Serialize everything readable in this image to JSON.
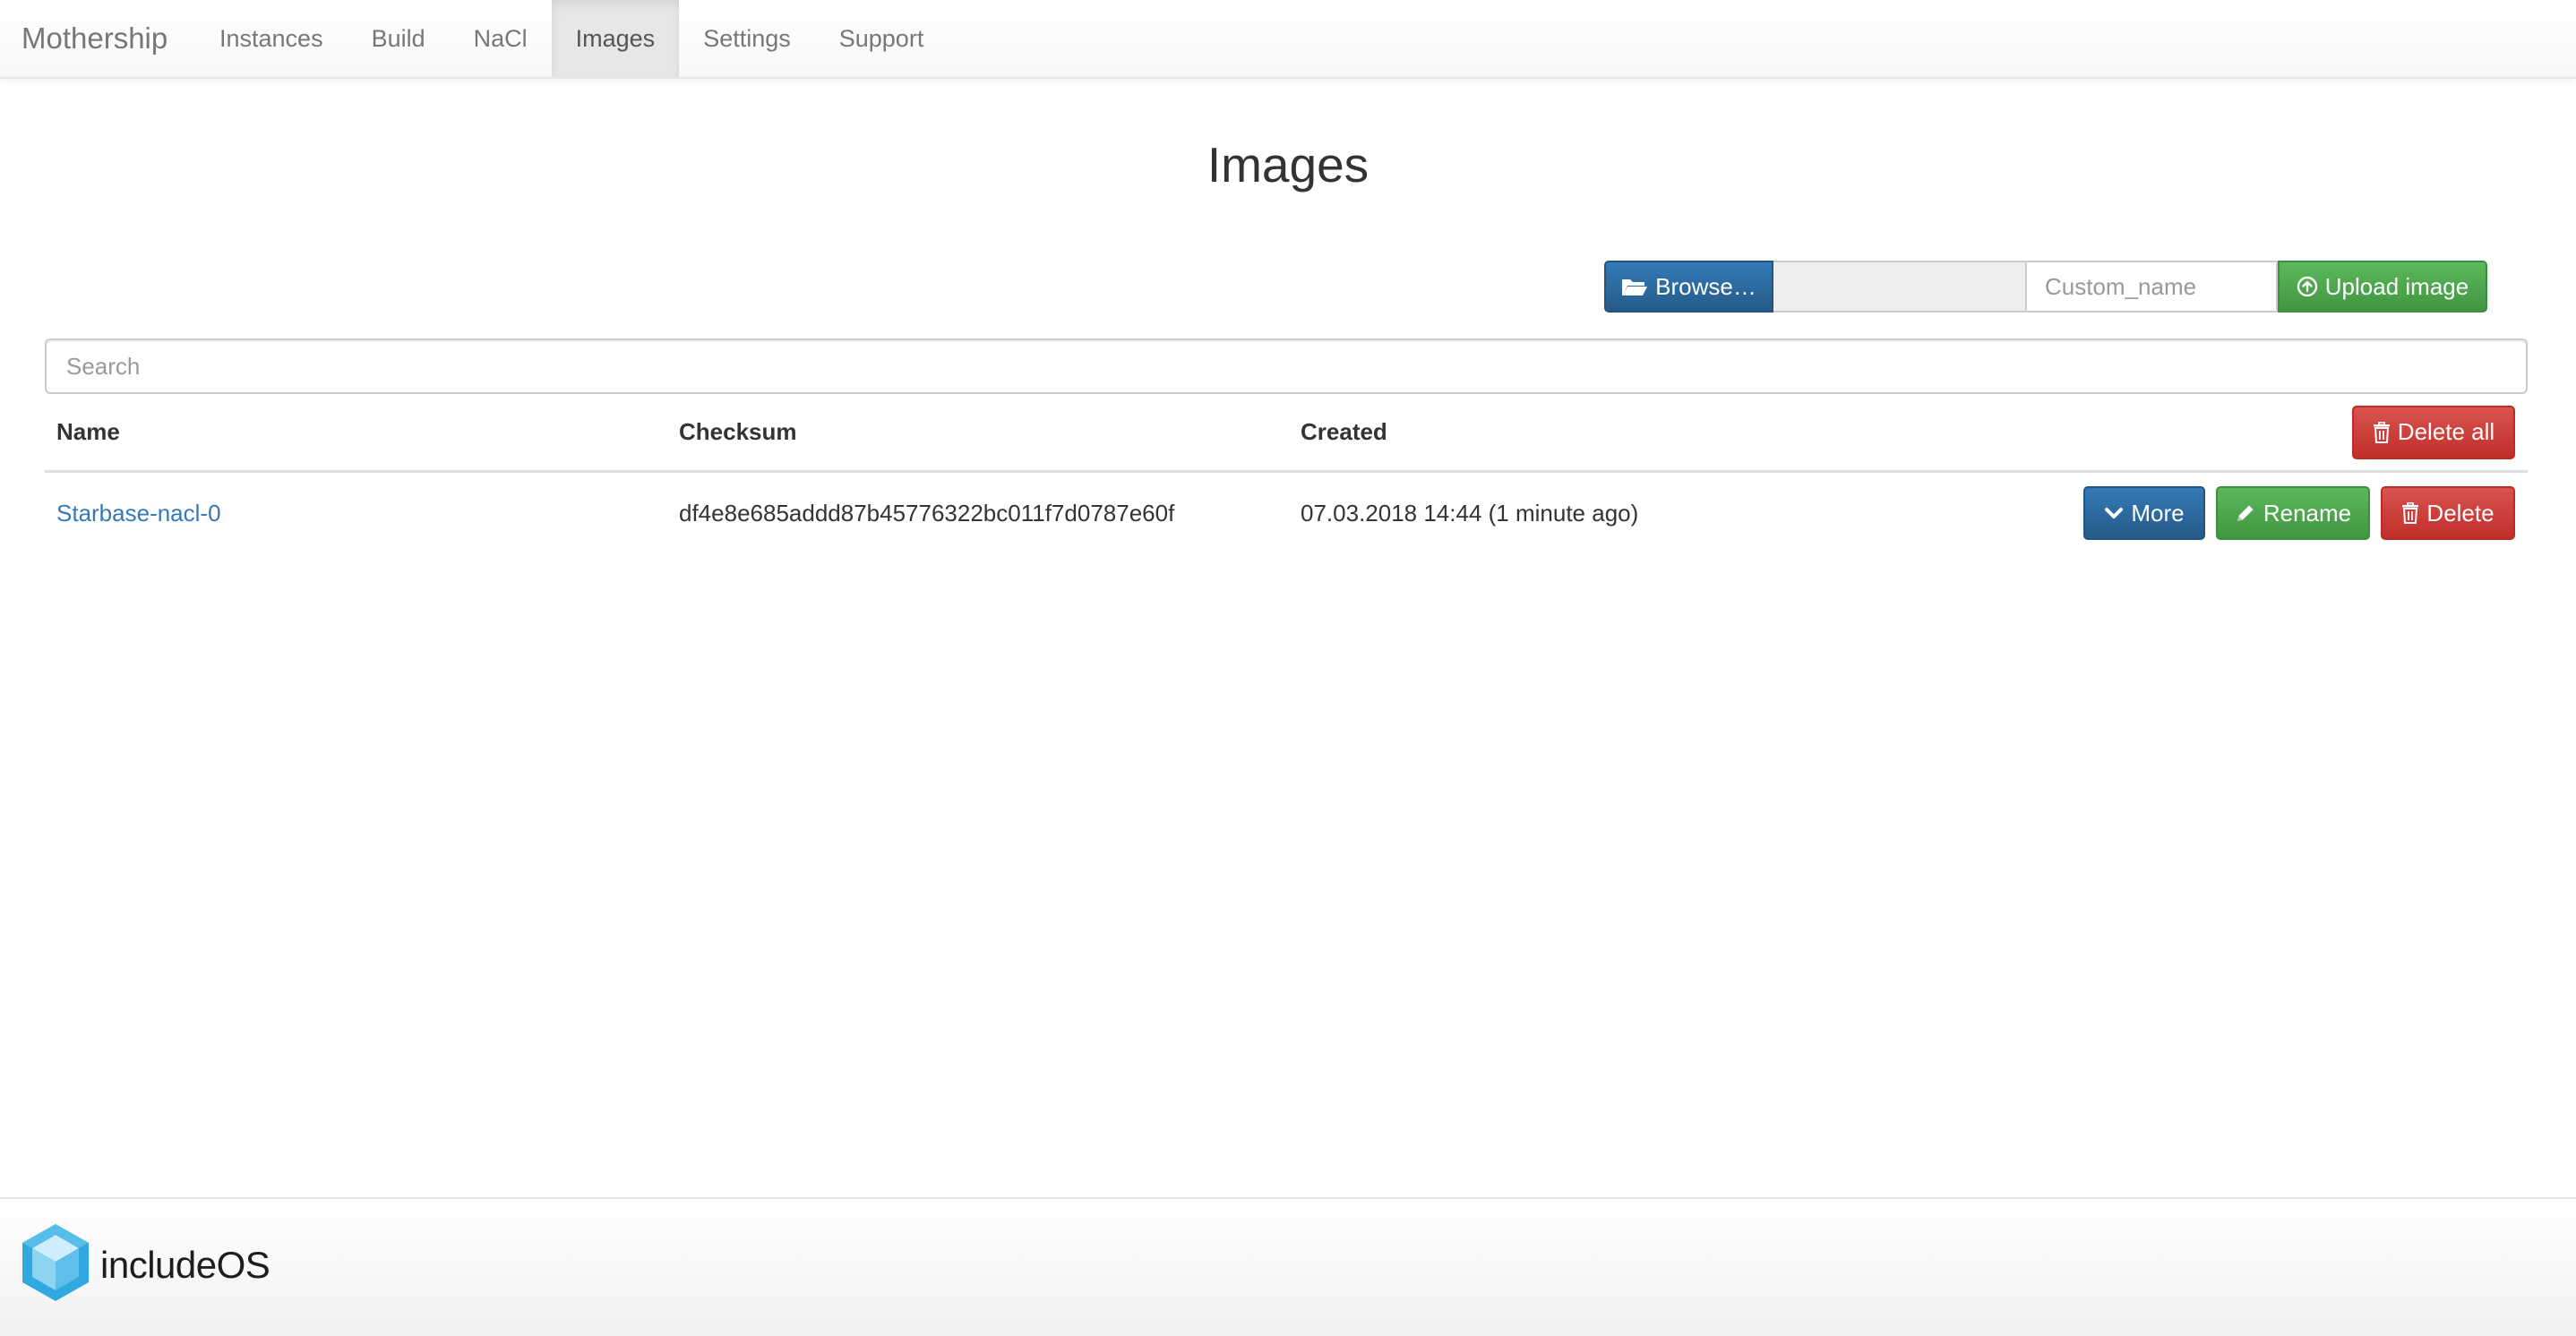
{
  "navbar": {
    "brand": "Mothership",
    "items": [
      {
        "label": "Instances",
        "active": false
      },
      {
        "label": "Build",
        "active": false
      },
      {
        "label": "NaCl",
        "active": false
      },
      {
        "label": "Images",
        "active": true
      },
      {
        "label": "Settings",
        "active": false
      },
      {
        "label": "Support",
        "active": false
      }
    ]
  },
  "page": {
    "title": "Images"
  },
  "upload": {
    "browse_label": "Browse…",
    "file_value": "",
    "custom_name_placeholder": "Custom_name",
    "upload_label": "Upload image"
  },
  "search": {
    "placeholder": "Search"
  },
  "table": {
    "headers": {
      "name": "Name",
      "checksum": "Checksum",
      "created": "Created",
      "delete_all_label": "Delete all"
    },
    "rows": [
      {
        "name": "Starbase-nacl-0",
        "checksum": "df4e8e685addd87b45776322bc011f7d0787e60f",
        "created": "07.03.2018 14:44 (1 minute ago)",
        "more_label": "More",
        "rename_label": "Rename",
        "delete_label": "Delete"
      }
    ]
  },
  "footer": {
    "logo_text": "includeOS"
  },
  "colors": {
    "primary": "#337ab7",
    "success": "#5cb85c",
    "danger": "#d9534f",
    "logo_blue": "#2fa9e0"
  }
}
